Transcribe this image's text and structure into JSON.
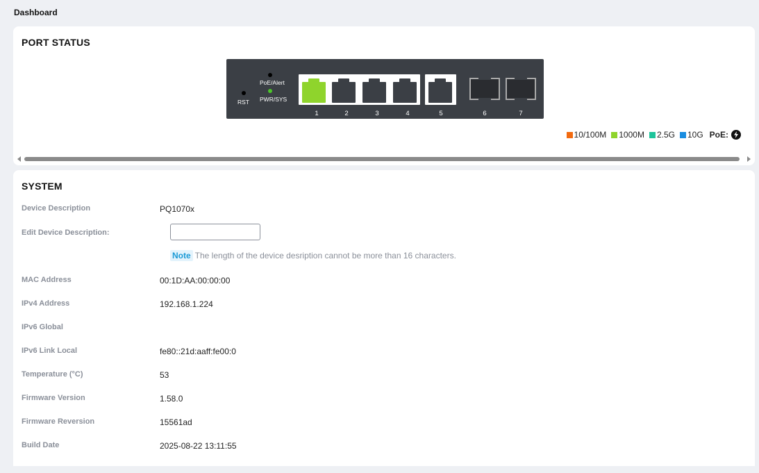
{
  "page": {
    "title": "Dashboard"
  },
  "port_status": {
    "title": "PORT STATUS",
    "panel": {
      "rst_label": "RST",
      "poe_alert_label": "PoE/Alert",
      "pwr_sys_label": "PWR/SYS",
      "ports": [
        {
          "number": "1",
          "kind": "rj45",
          "state": "1000M"
        },
        {
          "number": "2",
          "kind": "rj45",
          "state": "down"
        },
        {
          "number": "3",
          "kind": "rj45",
          "state": "down"
        },
        {
          "number": "4",
          "kind": "rj45",
          "state": "down"
        },
        {
          "number": "5",
          "kind": "rj45",
          "state": "down"
        },
        {
          "number": "6",
          "kind": "sfp",
          "state": "down"
        },
        {
          "number": "7",
          "kind": "sfp",
          "state": "down"
        }
      ]
    },
    "legend": {
      "items": [
        {
          "label": "10/100M",
          "color": "#f26a10"
        },
        {
          "label": "1000M",
          "color": "#8fd42c"
        },
        {
          "label": "2.5G",
          "color": "#1ec39a"
        },
        {
          "label": "10G",
          "color": "#1a8de0"
        }
      ],
      "poe_label": "PoE:",
      "poe_icon": "lightning-icon"
    }
  },
  "system": {
    "title": "SYSTEM",
    "device_description": {
      "label": "Device Description",
      "value": "PQ1070x"
    },
    "edit_description": {
      "label": "Edit Device Description:",
      "value": "",
      "placeholder": ""
    },
    "note": {
      "tag": "Note",
      "text": "The length of the device desription cannot be more than 16 characters."
    },
    "mac": {
      "label": "MAC Address",
      "value": "00:1D:AA:00:00:00"
    },
    "ipv4": {
      "label": "IPv4 Address",
      "value": "192.168.1.224"
    },
    "ipv6_global": {
      "label": "IPv6 Global",
      "value": ""
    },
    "ipv6_link_local": {
      "label": "IPv6 Link Local",
      "value": "fe80::21d:aaff:fe00:0"
    },
    "temperature": {
      "label": "Temperature (°C)",
      "value": "53"
    },
    "firmware_version": {
      "label": "Firmware Version",
      "value": "1.58.0"
    },
    "firmware_reversion": {
      "label": "Firmware Reversion",
      "value": "15561ad"
    },
    "build_date": {
      "label": "Build Date",
      "value": "2025-08-22 13:11:55"
    }
  }
}
